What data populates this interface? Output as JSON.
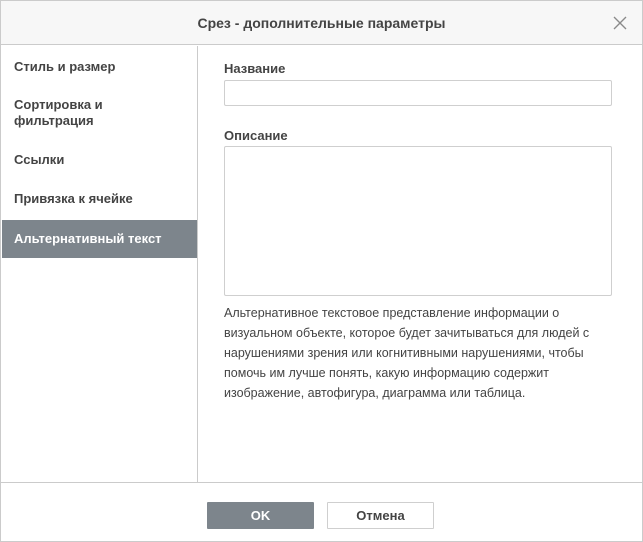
{
  "dialog": {
    "title": "Срез - дополнительные параметры"
  },
  "sidebar": {
    "items": [
      {
        "label": "Стиль и размер",
        "active": false
      },
      {
        "label": "Сортировка и фильтрация",
        "active": false
      },
      {
        "label": "Ссылки",
        "active": false
      },
      {
        "label": "Привязка к ячейке",
        "active": false
      },
      {
        "label": "Альтернативный текст",
        "active": true
      }
    ]
  },
  "form": {
    "name_label": "Название",
    "name_value": "",
    "description_label": "Описание",
    "description_value": "",
    "hint": "Альтернативное текстовое представление информации о визуальном объекте, которое будет зачитываться для людей с нарушениями зрения или когнитивными нарушениями, чтобы помочь им лучше понять, какую информацию содержит изображение, автофигура, диаграмма или таблица."
  },
  "footer": {
    "ok_label": "OK",
    "cancel_label": "Отмена"
  },
  "colors": {
    "accent": "#7d858c",
    "border": "#cbcbcb",
    "header_bg": "#f7f7f7",
    "text": "#444444"
  },
  "icons": {
    "close": "close-icon"
  }
}
